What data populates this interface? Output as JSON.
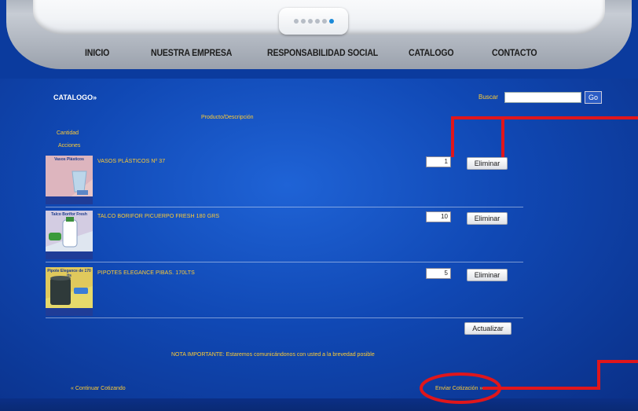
{
  "header": {
    "nav": [
      {
        "label": "INICIO"
      },
      {
        "label": "NUESTRA EMPRESA"
      },
      {
        "label": "RESPONSABILIDAD SOCIAL"
      },
      {
        "label": "CATALOGO"
      },
      {
        "label": "CONTACTO"
      }
    ],
    "slider_dots": 6,
    "active_dot": 6
  },
  "catalog": {
    "title": "CATALOGO»",
    "search_label": "Buscar",
    "search_value": "",
    "go_label": "Go",
    "column_header": "Producto/Descripción",
    "quantity_header": "Cantidad",
    "actions_header": "Acciones"
  },
  "items": [
    {
      "name": "VASOS PLÁSTICOS Nº 37",
      "qty": "1",
      "remove_label": "Eliminar",
      "thumb_label": "Vasos Plásticos",
      "thumb_color": "#e9c7c7"
    },
    {
      "name": "TALCO BORIFOR PICUERPO FRESH 180 GRS",
      "qty": "10",
      "remove_label": "Eliminar",
      "thumb_label": "Talco Borifor Fresh",
      "thumb_color": "#dfe6f0"
    },
    {
      "name": "PIPOTES ELEGANCE PIBAS. 170LTS",
      "qty": "5",
      "remove_label": "Eliminar",
      "thumb_label": "Pipote Elegance de 170 lts",
      "thumb_color": "#e6d96a"
    }
  ],
  "actions": {
    "update_label": "Actualizar",
    "note": "NOTA IMPORTANTE: Estaremos comunicándonos con usted a la brevedad posible",
    "continue_label": "« Continuar Cotizando",
    "send_label": "Enviar Cotización »"
  },
  "colors": {
    "background": "#1048b4",
    "link_yellow": "#ffcc33",
    "annotation_red": "#e0161b"
  }
}
